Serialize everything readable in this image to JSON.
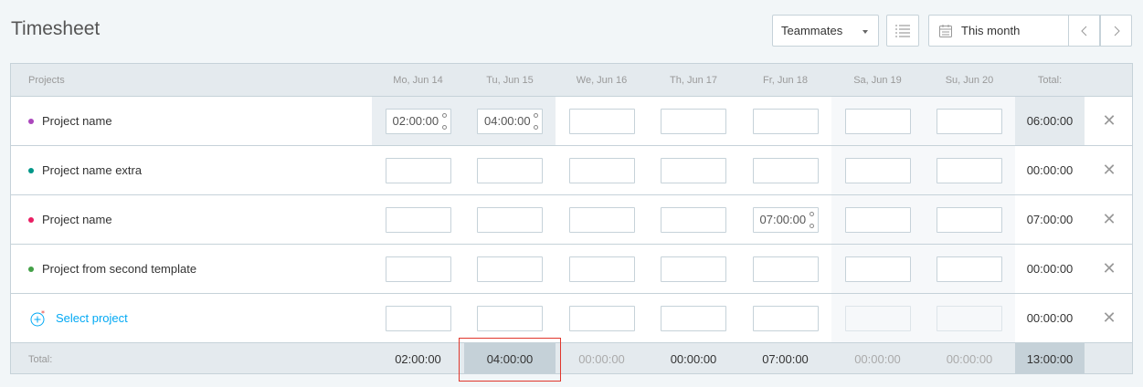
{
  "header": {
    "title": "Timesheet",
    "teammates_label": "Teammates",
    "range_label": "This month",
    "prev_label": "‹",
    "next_label": "›"
  },
  "table": {
    "projects_header": "Projects",
    "days": [
      "Mo, Jun 14",
      "Tu, Jun 15",
      "We, Jun 16",
      "Th, Jun 17",
      "Fr, Jun 18",
      "Sa, Jun 19",
      "Su, Jun 20"
    ],
    "total_header": "Total:",
    "rows": [
      {
        "name": "Project name",
        "color": "#ab47bc",
        "values": [
          "02:00:00",
          "04:00:00",
          "",
          "",
          "",
          "",
          ""
        ],
        "total": "06:00:00"
      },
      {
        "name": "Project name extra",
        "color": "#009688",
        "values": [
          "",
          "",
          "",
          "",
          "",
          "",
          ""
        ],
        "total": "00:00:00"
      },
      {
        "name": "Project name",
        "color": "#e91e63",
        "values": [
          "",
          "",
          "",
          "",
          "07:00:00",
          "",
          ""
        ],
        "total": "07:00:00"
      },
      {
        "name": "Project from second template",
        "color": "#43a047",
        "values": [
          "",
          "",
          "",
          "",
          "",
          "",
          ""
        ],
        "total": "00:00:00"
      }
    ],
    "select_project_label": "Select project",
    "select_total": "00:00:00",
    "totals_label": "Total:",
    "day_totals": [
      "02:00:00",
      "04:00:00",
      "00:00:00",
      "00:00:00",
      "07:00:00",
      "00:00:00",
      "00:00:00"
    ],
    "grand_total": "13:00:00"
  },
  "colors": {
    "accent": "#03a9f4",
    "highlight_border": "#e0362c"
  }
}
